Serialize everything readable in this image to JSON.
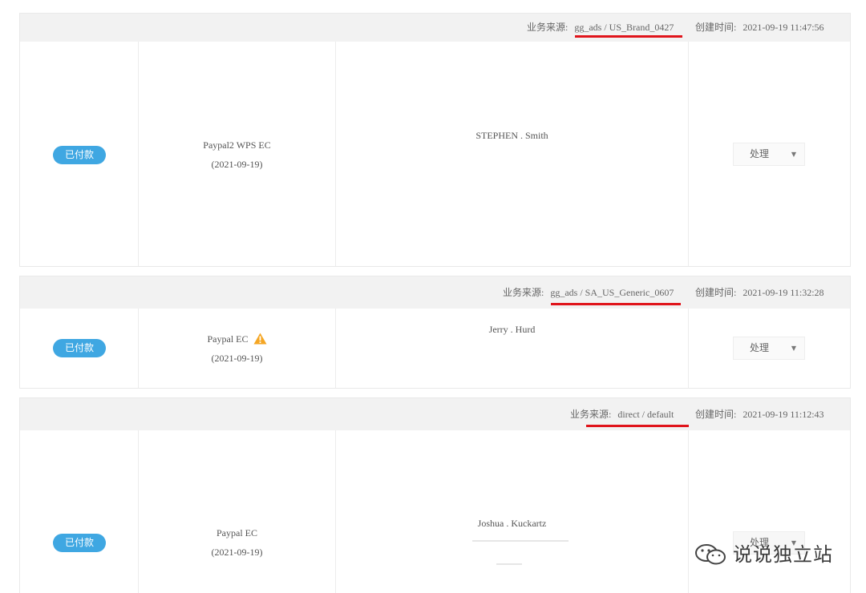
{
  "orders": [
    {
      "source_label": "业务来源:",
      "source_value": "gg_ads / US_Brand_0427",
      "created_label": "创建时间:",
      "created_value": "2021-09-19 11:47:56",
      "status": "已付款",
      "payment_method": "Paypal2 WPS EC",
      "payment_date": "(2021-09-19)",
      "customer": "STEPHEN . Smith",
      "action": "处理"
    },
    {
      "source_label": "业务来源:",
      "source_value": "gg_ads / SA_US_Generic_0607",
      "created_label": "创建时间:",
      "created_value": "2021-09-19 11:32:28",
      "status": "已付款",
      "payment_method": "Paypal EC",
      "payment_date": "(2021-09-19)",
      "customer": "Jerry . Hurd",
      "action": "处理"
    },
    {
      "source_label": "业务来源:",
      "source_value": "direct / default",
      "created_label": "创建时间:",
      "created_value": "2021-09-19 11:12:43",
      "status": "已付款",
      "payment_method": "Paypal EC",
      "payment_date": "(2021-09-19)",
      "customer": "Joshua . Kuckartz",
      "action": "处理"
    }
  ],
  "watermark": {
    "text": "说说独立站",
    "icon": "wechat-icon"
  },
  "colors": {
    "badge": "#3fa7e2",
    "underline": "#e0141b",
    "header_bg": "#f2f2f2",
    "warning": "#f5a623"
  }
}
